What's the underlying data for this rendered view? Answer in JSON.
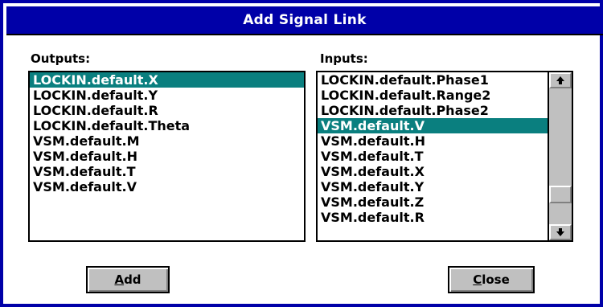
{
  "dialog": {
    "title": "Add Signal Link"
  },
  "outputs": {
    "label": "Outputs:",
    "items": [
      {
        "label": "LOCKIN.default.X",
        "selected": true
      },
      {
        "label": "LOCKIN.default.Y",
        "selected": false
      },
      {
        "label": "LOCKIN.default.R",
        "selected": false
      },
      {
        "label": "LOCKIN.default.Theta",
        "selected": false
      },
      {
        "label": "VSM.default.M",
        "selected": false
      },
      {
        "label": "VSM.default.H",
        "selected": false
      },
      {
        "label": "VSM.default.T",
        "selected": false
      },
      {
        "label": "VSM.default.V",
        "selected": false
      }
    ]
  },
  "inputs": {
    "label": "Inputs:",
    "items": [
      {
        "label": "LOCKIN.default.Phase1",
        "selected": false
      },
      {
        "label": "LOCKIN.default.Range2",
        "selected": false
      },
      {
        "label": "LOCKIN.default.Phase2",
        "selected": false
      },
      {
        "label": "VSM.default.V",
        "selected": true
      },
      {
        "label": "VSM.default.H",
        "selected": false
      },
      {
        "label": "VSM.default.T",
        "selected": false
      },
      {
        "label": "VSM.default.X",
        "selected": false
      },
      {
        "label": "VSM.default.Y",
        "selected": false
      },
      {
        "label": "VSM.default.Z",
        "selected": false
      },
      {
        "label": "VSM.default.R",
        "selected": false
      }
    ],
    "scroll_position": 0.82
  },
  "buttons": {
    "add": {
      "mnemonic": "A",
      "rest": "dd"
    },
    "close": {
      "mnemonic": "C",
      "rest": "lose"
    }
  },
  "colors": {
    "title_bar": "#0000a8",
    "selection": "#0a7f7f",
    "button_face": "#c0c0c0"
  }
}
